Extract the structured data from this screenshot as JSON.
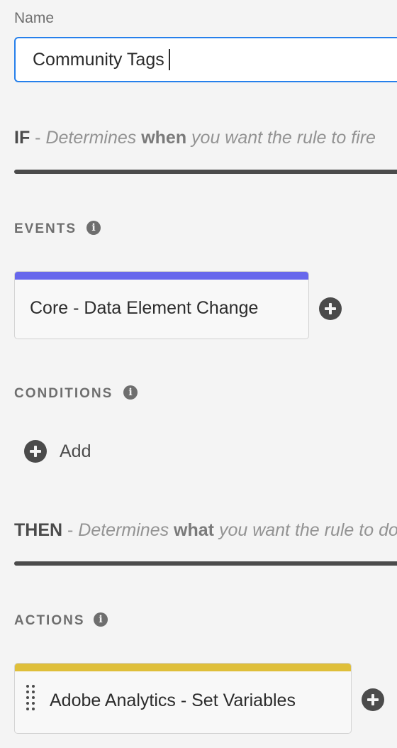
{
  "name_field": {
    "label": "Name",
    "value": "Community Tags"
  },
  "if_section": {
    "keyword": "IF",
    "dash": " - ",
    "desc_part1": "Determines ",
    "desc_emphasis": "when",
    "desc_part2": " you want the rule to fire"
  },
  "events": {
    "label": "EVENTS",
    "info_icon": "info-icon",
    "items": [
      {
        "label": "Core - Data Element Change",
        "stripe_color": "#6767ec"
      }
    ],
    "add_icon": "plus-circle-icon"
  },
  "conditions": {
    "label": "CONDITIONS",
    "info_icon": "info-icon",
    "add_label": "Add",
    "add_icon": "plus-circle-icon"
  },
  "then_section": {
    "keyword": "THEN",
    "dash": " - ",
    "desc_part1": "Determines ",
    "desc_emphasis": "what",
    "desc_part2": " you want the rule to do"
  },
  "actions": {
    "label": "ACTIONS",
    "info_icon": "info-icon",
    "items": [
      {
        "label": "Adobe Analytics - Set Variables",
        "stripe_color": "#dfbf3a",
        "drag_icon": "drag-handle-icon"
      }
    ],
    "add_icon": "plus-circle-icon"
  },
  "colors": {
    "focus_border": "#2680eb",
    "background": "#f4f4f4",
    "text_primary": "#2c2c2c",
    "text_secondary": "#6e6e6e"
  }
}
